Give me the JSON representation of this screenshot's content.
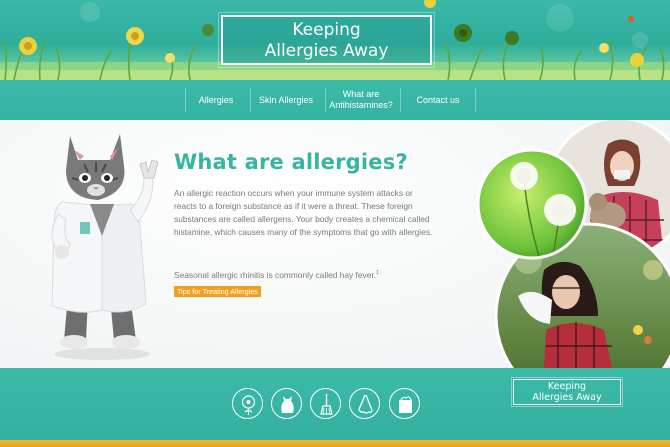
{
  "brand": {
    "logo_line1": "Keeping",
    "logo_line2": "Allergies Away"
  },
  "nav": {
    "items": [
      {
        "label": "Allergies"
      },
      {
        "label": "Skin Allergies"
      },
      {
        "label": "What are Antihistamines?"
      },
      {
        "label": "Contact us"
      }
    ]
  },
  "main": {
    "title": "What are allergies?",
    "paragraph": "An allergic reaction occurs when your immune system attacks or reacts to a foreign substance as if it were a threat. These foreign substances are called allergens. Your body creates a chemical called histamine, which causes many of the symptoms that go with allergies.",
    "paragraph2": "Seasonal allergic rhinitis is commonly called hay fever.",
    "footnote_ref": "1",
    "tips_button": "Tips for Treating Allergies"
  },
  "footer": {
    "icons": [
      "dandelion-icon",
      "cat-icon",
      "dust-broom-icon",
      "nose-icon",
      "sponge-icon"
    ],
    "logo_line1": "Keeping",
    "logo_line2": "Allergies Away"
  },
  "colors": {
    "teal": "#39b4a3",
    "accent_orange": "#f0a020",
    "body_text": "#7a7a7a"
  }
}
